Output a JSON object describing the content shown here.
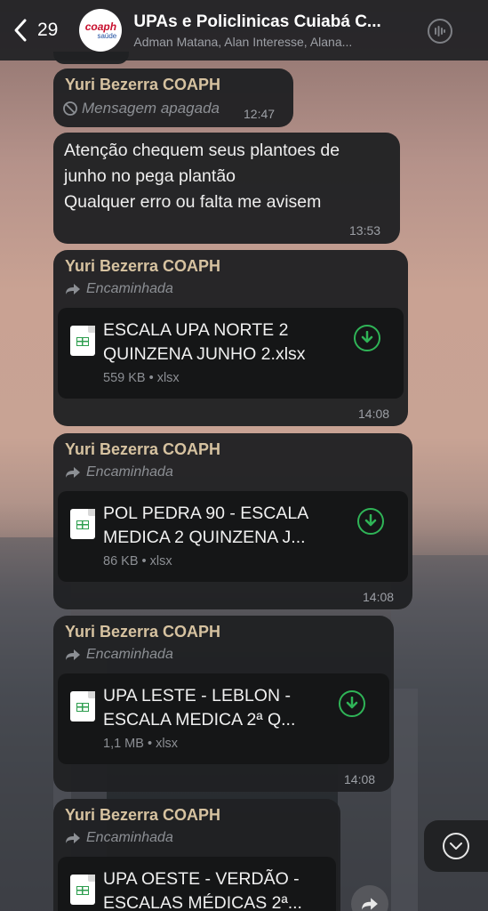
{
  "header": {
    "back_count": "29",
    "avatar_line1": "coaph",
    "avatar_line2": "saúde",
    "title": "UPAs e Policlinicas Cuiabá C...",
    "subtitle": "Adman Matana, Alan Interesse, Alana..."
  },
  "messages": {
    "deleted": {
      "sender": "Yuri Bezerra COAPH",
      "text": "Mensagem apagada",
      "time": "12:47"
    },
    "text": {
      "line1": "Atenção chequem seus plantoes de",
      "line2": "junho no pega plantão",
      "line3": "Qualquer erro ou falta me avisem",
      "time": "13:53"
    },
    "file1": {
      "sender": "Yuri Bezerra COAPH",
      "forwarded": "Encaminhada",
      "name_line1": "ESCALA UPA NORTE 2",
      "name_line2": "QUINZENA JUNHO 2.xlsx",
      "meta": "559 KB • xlsx",
      "time": "14:08"
    },
    "file2": {
      "sender": "Yuri Bezerra COAPH",
      "forwarded": "Encaminhada",
      "name_line1": "POL PEDRA 90 - ESCALA",
      "name_line2": "MEDICA 2 QUINZENA  J...",
      "meta": "86 KB • xlsx",
      "time": "14:08"
    },
    "file3": {
      "sender": "Yuri Bezerra COAPH",
      "forwarded": "Encaminhada",
      "name_line1": "UPA LESTE - LEBLON -",
      "name_line2": "ESCALA MEDICA 2ª Q...",
      "meta": "1,1 MB • xlsx",
      "time": "14:08"
    },
    "file4": {
      "sender": "Yuri Bezerra COAPH",
      "forwarded": "Encaminhada",
      "name_line1": "UPA OESTE - VERDÃO -",
      "name_line2": "ESCALAS MÉDICAS 2ª..."
    }
  },
  "colors": {
    "sender": "#d6c2a0",
    "download": "#2fb457",
    "bubble": "#202123"
  }
}
